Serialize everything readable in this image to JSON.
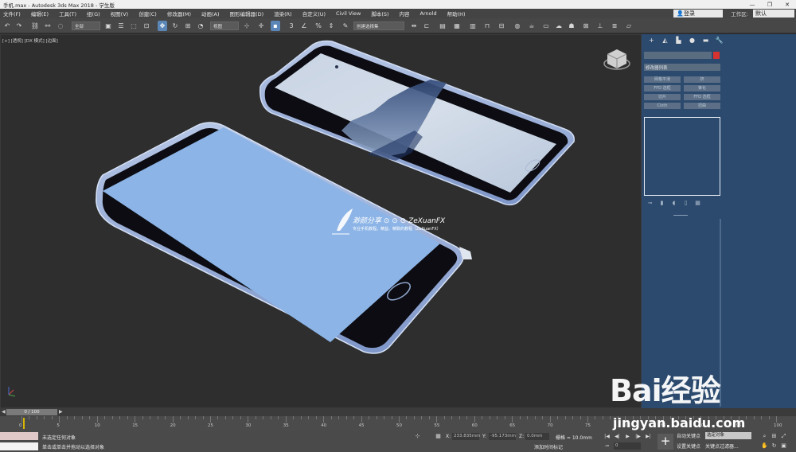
{
  "window": {
    "title": "手机.max - Autodesk 3ds Max 2018  -  学生版",
    "buttons": [
      "—",
      "❐",
      "✕"
    ]
  },
  "menubar": {
    "items": [
      "文件(F)",
      "编辑(E)",
      "工具(T)",
      "组(G)",
      "视图(V)",
      "创建(C)",
      "修改器(M)",
      "动画(A)",
      "图形编辑器(D)",
      "渲染(R)",
      "自定义(U)",
      "Civil View",
      "脚本(S)",
      "内容",
      "Arnold",
      "帮助(H)"
    ],
    "login": "登录",
    "workspace_label": "工作区:",
    "workspace_value": "默认"
  },
  "toolbar": {
    "filter_dropdown": "全部",
    "refcoord_dropdown": "视图",
    "named_sel_dropdown": "创建选择集"
  },
  "viewport": {
    "label": "[+] [透视] [DX 模式] [边面]"
  },
  "logo": {
    "text": "渺颜分享 ⊙ ⊙ ⊙ ZeXuanFX",
    "sub": "专业手机教程。精益、精致的教程（ZeXuanFX）"
  },
  "command_panel": {
    "modifier_list": "修改器列表",
    "modifier_buttons": [
      "网格平滑",
      "挤",
      "FFD 选框",
      "锥化",
      "切片",
      "FFD 选框",
      "Cloth",
      "扭曲"
    ]
  },
  "time_slider": {
    "value": "0 / 100",
    "ticks": [
      "0",
      "5",
      "10",
      "15",
      "20",
      "25",
      "30",
      "35",
      "40",
      "45",
      "50",
      "55",
      "60",
      "65",
      "70",
      "75",
      "80",
      "85",
      "90",
      "95",
      "100"
    ]
  },
  "status": {
    "line1": "未选定任何对象",
    "line2": "单击或单击并拖动以选择对象",
    "x_label": "X:",
    "x_value": "233.835mm",
    "y_label": "Y:",
    "y_value": "-95.173mm",
    "z_label": "Z:",
    "z_value": "0.0mm",
    "grid": "栅格 = 10.0mm",
    "add_time_tag": "添加时间标记",
    "frame": "0",
    "auto_key": "自动关键点",
    "set_key": "设置关键点",
    "selection_dropdown": "选定对象",
    "key_filters": "关键点过滤器..."
  },
  "watermark": {
    "brand": "Bai经验",
    "url": "jingyan.baidu.com"
  },
  "colors": {
    "viewport_bg": "#2e2e2e",
    "panel_blue": "#2c4a6e",
    "phone_screen": "#8cb4e6",
    "phone_frame": "#9ab4e4",
    "phone_bezel": "#0c0c12",
    "active_tool": "#5b86b8",
    "keyframe": "#d6b400"
  }
}
